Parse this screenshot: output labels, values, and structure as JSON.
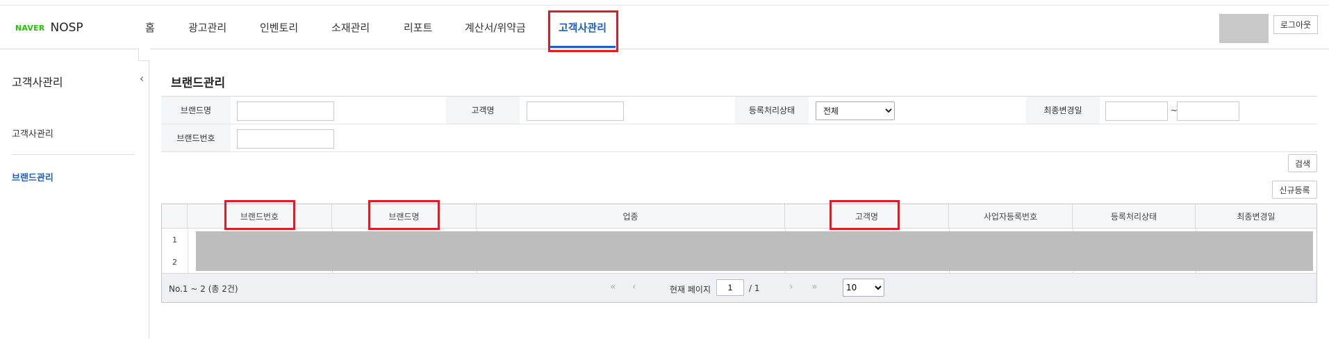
{
  "header": {
    "logo_brand": "NAVER",
    "logo_product": "NOSP",
    "tabs": [
      {
        "label": "홈"
      },
      {
        "label": "광고관리"
      },
      {
        "label": "인벤토리"
      },
      {
        "label": "소재관리"
      },
      {
        "label": "리포트"
      },
      {
        "label": "계산서/위약금"
      },
      {
        "label": "고객사관리",
        "active": true
      }
    ],
    "logout_label": "로그아웃"
  },
  "sidebar": {
    "title": "고객사관리",
    "collapse_icon": "chevron-left-icon",
    "items": [
      {
        "label": "고객사관리",
        "active": false
      },
      {
        "label": "브랜드관리",
        "active": true
      }
    ]
  },
  "main": {
    "page_title": "브랜드관리",
    "filters": {
      "brand_name_label": "브랜드명",
      "brand_name_value": "",
      "customer_name_label": "고객명",
      "customer_name_value": "",
      "status_label": "등록처리상태",
      "status_selected": "전체",
      "modified_date_label": "최종변경일",
      "date_from": "",
      "date_separator": "~",
      "date_to": "",
      "brand_no_label": "브랜드번호",
      "brand_no_value": ""
    },
    "search_button": "검색",
    "new_button": "신규등록",
    "grid": {
      "columns": [
        "브랜드번호",
        "브랜드명",
        "업종",
        "고객명",
        "사업자등록번호",
        "등록처리상태",
        "최종변경일"
      ],
      "row_numbers": [
        "1",
        "2"
      ],
      "footer_count": "No.1 ~ 2 (총 2건)",
      "page_label": "현재 페이지",
      "current_page": "1",
      "total_pages": "/ 1",
      "page_size": "10"
    }
  },
  "colors": {
    "accent": "#1a5fc4",
    "naver_green": "#1ec800",
    "highlight_red": "#e01b24"
  }
}
